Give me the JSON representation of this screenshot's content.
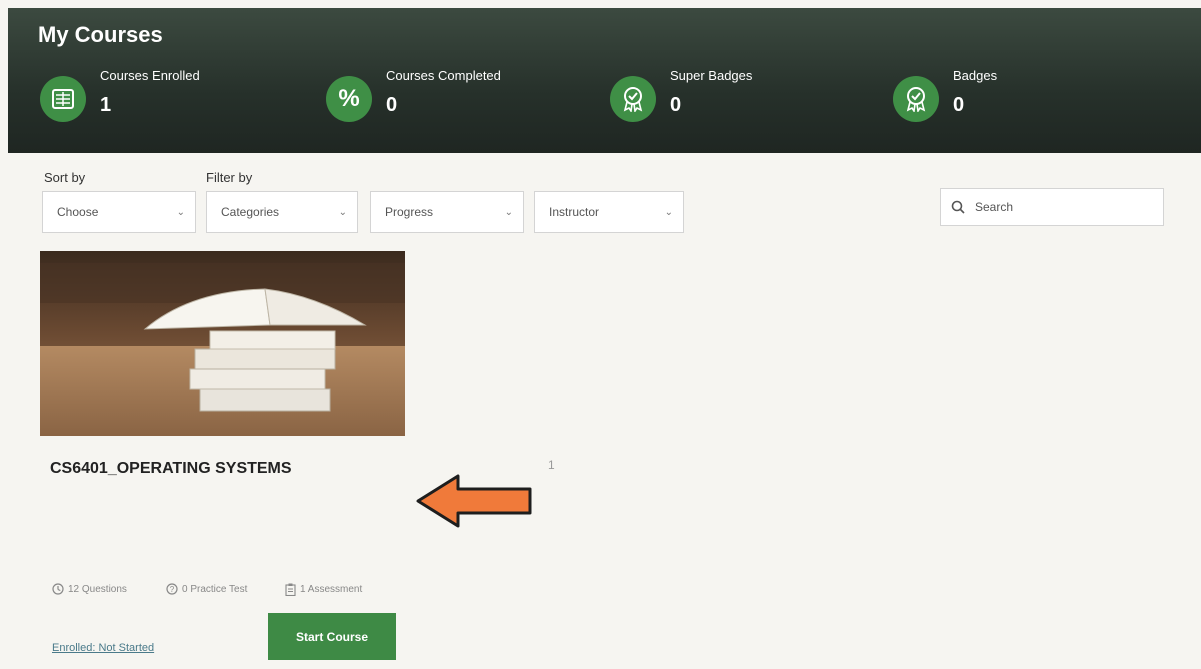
{
  "header": {
    "title": "My Courses",
    "stats": [
      {
        "label": "Courses Enrolled",
        "value": "1",
        "icon": "ledger-icon"
      },
      {
        "label": "Courses Completed",
        "value": "0",
        "icon": "percent-icon"
      },
      {
        "label": "Super Badges",
        "value": "0",
        "icon": "award-icon"
      },
      {
        "label": "Badges",
        "value": "0",
        "icon": "award-icon"
      }
    ]
  },
  "filters": {
    "sort_label": "Sort by",
    "filter_label": "Filter by",
    "sort_select": "Choose",
    "categories_select": "Categories",
    "progress_select": "Progress",
    "instructor_select": "Instructor",
    "search_placeholder": "Search"
  },
  "course": {
    "title": "CS6401_OPERATING SYSTEMS",
    "stray_mark": "1",
    "meta": [
      {
        "text": "12 Questions",
        "icon": "clock-icon"
      },
      {
        "text": "0 Practice Test",
        "icon": "question-icon"
      },
      {
        "text": "1 Assessment",
        "icon": "clipboard-icon"
      }
    ],
    "status": "Enrolled: Not Started",
    "start_label": "Start Course"
  },
  "colors": {
    "accent": "#3e8a45",
    "header_bg": "#26302a",
    "arrow": "#f07a3a"
  }
}
